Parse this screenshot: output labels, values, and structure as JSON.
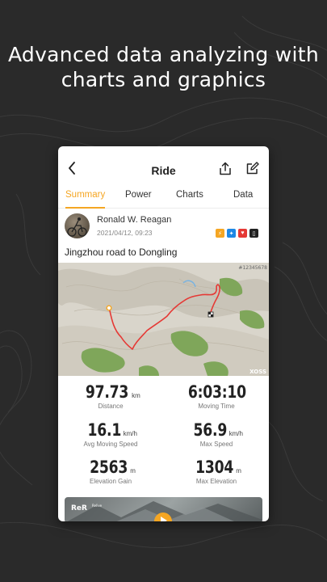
{
  "headline": {
    "line1": "Advanced data analyzing with",
    "line2": "charts and graphics"
  },
  "card": {
    "header": {
      "title": "Ride",
      "icons": [
        "back-arrow-icon",
        "share-icon",
        "edit-icon"
      ]
    },
    "tabs": [
      {
        "label": "Summary",
        "active": true
      },
      {
        "label": "Power",
        "active": false
      },
      {
        "label": "Charts",
        "active": false
      },
      {
        "label": "Data",
        "active": false
      }
    ],
    "user": {
      "name": "Ronald W. Reagan",
      "date": "2021/04/12, 09:23"
    },
    "ride_title": "Jingzhou road to Dongling",
    "map": {
      "corner_label": "#12345678",
      "attribution": "XOSS"
    },
    "stats": [
      {
        "value": "97.73",
        "unit": "km",
        "label": "Distance"
      },
      {
        "value": "6:03:10",
        "unit": "",
        "label": "Moving Time"
      },
      {
        "value": "16.1",
        "unit": "km/h",
        "label": "Avg Moving Speed"
      },
      {
        "value": "56.9",
        "unit": "km/h",
        "label": "Max Speed"
      },
      {
        "value": "2563",
        "unit": "m",
        "label": "Elevation Gain"
      },
      {
        "value": "1304",
        "unit": "m",
        "label": "Max Elevation"
      }
    ],
    "banner": {
      "logo_text": "ReR",
      "logo_sub": "Relive"
    },
    "colors": {
      "accent": "#f5a623",
      "route": "#e53935",
      "background": "#2a2a2a"
    }
  }
}
